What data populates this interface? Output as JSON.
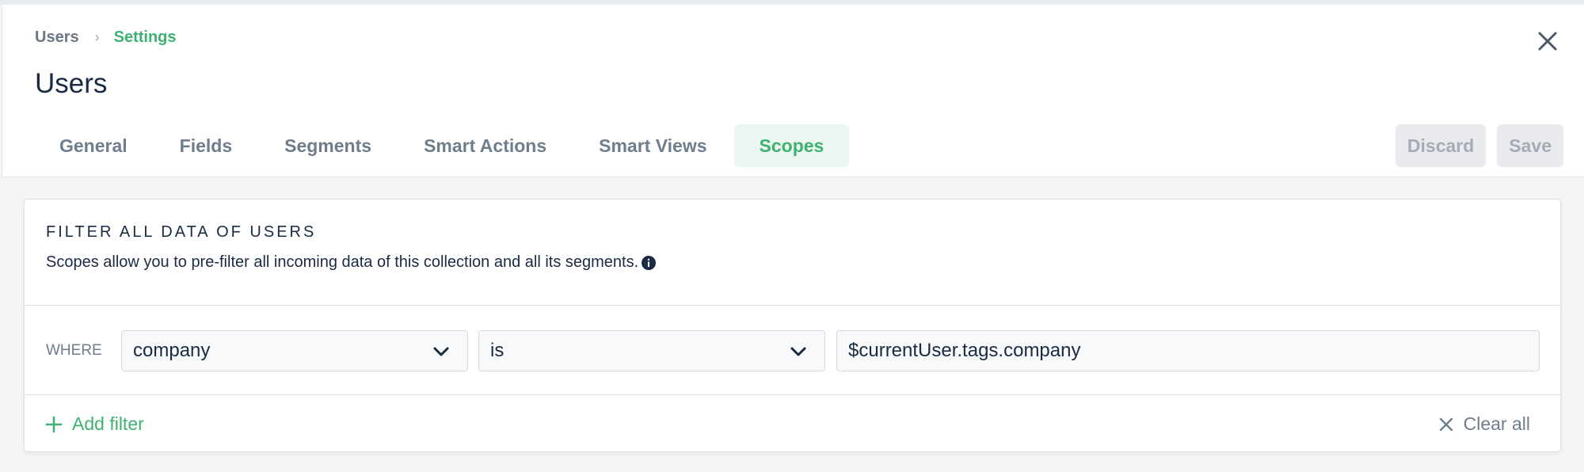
{
  "breadcrumb": {
    "parent": "Users",
    "separator": "›",
    "current": "Settings"
  },
  "page": {
    "title": "Users"
  },
  "tabs": [
    {
      "label": "General"
    },
    {
      "label": "Fields"
    },
    {
      "label": "Segments"
    },
    {
      "label": "Smart Actions"
    },
    {
      "label": "Smart Views"
    },
    {
      "label": "Scopes",
      "active": true
    }
  ],
  "actions": {
    "discard_label": "Discard",
    "save_label": "Save"
  },
  "scope_card": {
    "title": "FILTER ALL DATA OF USERS",
    "description": "Scopes allow you to pre-filter all incoming data of this collection and all its segments."
  },
  "filter": {
    "where_label": "WHERE",
    "field_value": "company",
    "operator_value": "is",
    "value": "$currentUser.tags.company"
  },
  "footer": {
    "add_filter_label": "Add filter",
    "clear_all_label": "Clear all"
  },
  "icons": {
    "close": "close-icon",
    "info": "info-icon",
    "chevron": "chevron-down-icon",
    "plus": "plus-icon",
    "clear": "x-icon"
  },
  "colors": {
    "accent": "#3fb172",
    "text_dark": "#1b2a44",
    "text_muted": "#6f7d8c"
  }
}
